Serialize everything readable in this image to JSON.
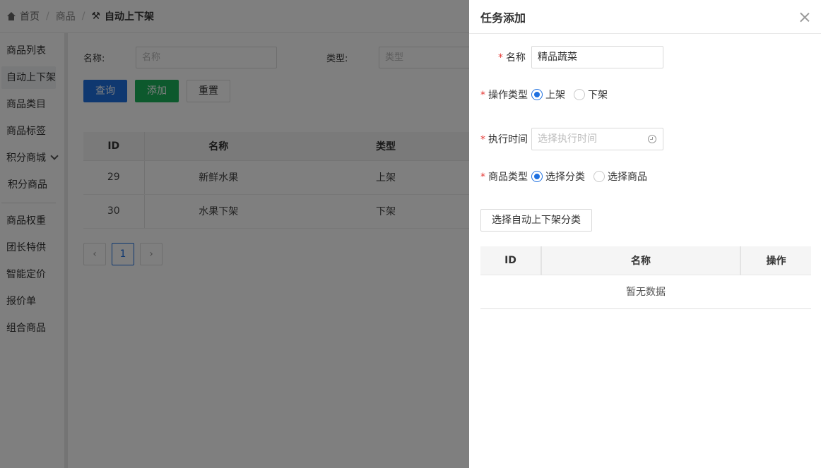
{
  "breadcrumb": {
    "home": "首页",
    "section": "商品",
    "current": "自动上下架"
  },
  "sidebar": {
    "items": [
      {
        "label": "商品列表"
      },
      {
        "label": "自动上下架"
      },
      {
        "label": "商品类目"
      },
      {
        "label": "商品标签"
      },
      {
        "label": "积分商城"
      },
      {
        "label": "积分商品"
      },
      {
        "label": "商品权重"
      },
      {
        "label": "团长特供"
      },
      {
        "label": "智能定价"
      },
      {
        "label": "报价单"
      },
      {
        "label": "组合商品"
      }
    ]
  },
  "filter": {
    "name_label": "名称:",
    "name_placeholder": "名称",
    "type_label": "类型:",
    "type_placeholder": "类型"
  },
  "actions": {
    "query": "查询",
    "add": "添加",
    "reset": "重置"
  },
  "bg_table": {
    "headers": [
      "ID",
      "名称",
      "类型"
    ],
    "rows": [
      [
        "29",
        "新鲜水果",
        "上架"
      ],
      [
        "30",
        "水果下架",
        "下架"
      ]
    ]
  },
  "pagination": {
    "prev": "‹",
    "current": "1",
    "next": "›"
  },
  "drawer": {
    "title": "任务添加",
    "name_label": "名称",
    "name_value": "精品蔬菜",
    "op_type_label": "操作类型",
    "op_options": [
      "上架",
      "下架"
    ],
    "exec_time_label": "执行时间",
    "exec_time_placeholder": "选择执行时间",
    "goods_type_label": "商品类型",
    "goods_options": [
      "选择分类",
      "选择商品"
    ],
    "select_button": "选择自动上下架分类",
    "table_headers": [
      "ID",
      "名称",
      "操作"
    ],
    "empty_text": "暂无数据"
  },
  "colors": {
    "primary": "#1e70e0",
    "success": "#1bb35b",
    "required": "#e53935"
  }
}
